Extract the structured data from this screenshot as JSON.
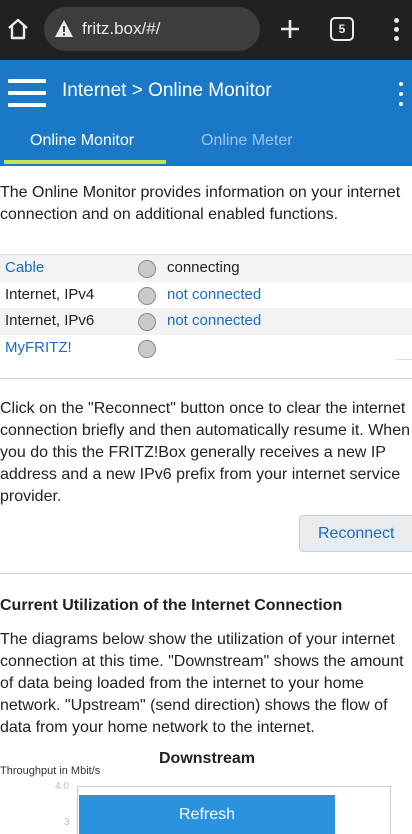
{
  "browser": {
    "url": "fritz.box/#/",
    "tab_count": "5"
  },
  "header": {
    "title": "Internet > Online Monitor",
    "tabs": [
      {
        "label": "Online Monitor",
        "active": true
      },
      {
        "label": "Online Meter",
        "active": false
      }
    ],
    "accent_color": "#1a78c6",
    "tab_indicator_color": "#c6e24b"
  },
  "intro": {
    "text": "The Online Monitor provides information on your internet connection and on additional enabled functions."
  },
  "status_rows": [
    {
      "name": "Cable",
      "state": "connecting"
    },
    {
      "name": "Internet, IPv4",
      "state": "not connected"
    },
    {
      "name": "Internet, IPv6",
      "state": "not connected"
    },
    {
      "name": "MyFRITZ!",
      "state": ""
    }
  ],
  "reconnect": {
    "text": "Click on the \"Reconnect\" button once to clear the internet connection briefly and then automatically resume it. When you do this the FRITZ!Box generally receives a new IP address and a new IPv6 prefix from your internet service provider.",
    "button_label": "Reconnect"
  },
  "utilization": {
    "heading": "Current Utilization of the Internet Connection",
    "text": "The diagrams below show the utilization of your internet connection at this time. \"Downstream\" shows the amount of data being loaded from the internet to your home network. \"Upstream\" (send direction) shows the flow of data from your home network to the internet."
  },
  "chart": {
    "title": "Downstream",
    "ylabel": "Throughput in Mbit/s",
    "ticks": [
      "4.0",
      "3"
    ]
  },
  "refresh_label": "Refresh"
}
